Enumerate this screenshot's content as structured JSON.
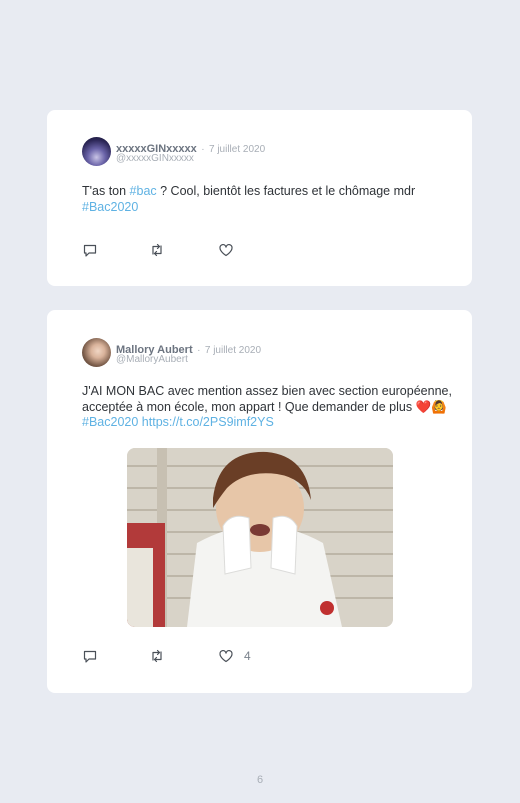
{
  "tweets": [
    {
      "display_name": "xxxxxGINxxxxx",
      "separator": "·",
      "date": "7 juillet 2020",
      "handle": "@xxxxxGINxxxxx",
      "text_parts": [
        "T'as ton ",
        "#bac",
        " ? Cool, bientôt les factures et le chômage mdr ",
        "#Bac2020"
      ],
      "like_count": ""
    },
    {
      "display_name": "Mallory Aubert",
      "separator": "·",
      "date": "7 juillet 2020",
      "handle": "@MalloryAubert",
      "text_parts": [
        "J'AI MON BAC avec mention assez bien avec section européenne, acceptée à mon école, mon appart ! Que demander de plus ",
        "❤️🙆",
        " ",
        "#Bac2020",
        " ",
        "https://t.co/2PS9imf2YS"
      ],
      "like_count": "4"
    }
  ],
  "icons": [
    "reply-icon",
    "retweet-icon",
    "heart-icon"
  ],
  "colors": {
    "background": "#e8ebf2",
    "card": "#ffffff",
    "link": "#5fb2e3",
    "meta": "#a8aeb6"
  },
  "page_number": "6"
}
